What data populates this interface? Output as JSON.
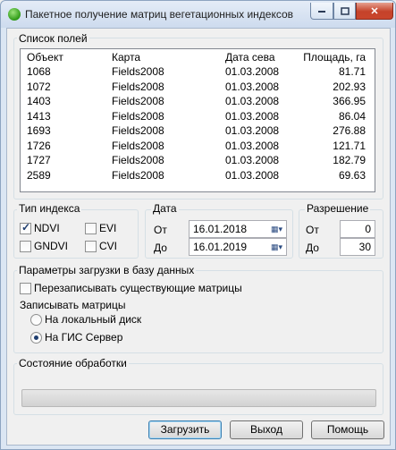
{
  "window": {
    "title": "Пакетное получение матриц вегетационных индексов",
    "close_glyph": "✕"
  },
  "fields_list": {
    "group_title": "Список полей",
    "columns": [
      "Объект",
      "Карта",
      "Дата сева",
      "Площадь, га"
    ],
    "rows": [
      [
        "1068",
        "Fields2008",
        "01.03.2008",
        "81.71"
      ],
      [
        "1072",
        "Fields2008",
        "01.03.2008",
        "202.93"
      ],
      [
        "1403",
        "Fields2008",
        "01.03.2008",
        "366.95"
      ],
      [
        "1413",
        "Fields2008",
        "01.03.2008",
        "86.04"
      ],
      [
        "1693",
        "Fields2008",
        "01.03.2008",
        "276.88"
      ],
      [
        "1726",
        "Fields2008",
        "01.03.2008",
        "121.71"
      ],
      [
        "1727",
        "Fields2008",
        "01.03.2008",
        "182.79"
      ],
      [
        "2589",
        "Fields2008",
        "01.03.2008",
        "69.63"
      ]
    ]
  },
  "index_type": {
    "group_title": "Тип индекса",
    "options": [
      {
        "label": "NDVI",
        "checked": true
      },
      {
        "label": "EVI",
        "checked": false
      },
      {
        "label": "GNDVI",
        "checked": false
      },
      {
        "label": "CVI",
        "checked": false
      }
    ]
  },
  "date": {
    "group_title": "Дата",
    "from_label": "От",
    "from_value": "16.01.2018",
    "to_label": "До",
    "to_value": "16.01.2019"
  },
  "resolution": {
    "group_title": "Разрешение",
    "from_label": "От",
    "from_value": "0",
    "to_label": "До",
    "to_value": "30"
  },
  "db_params": {
    "group_title": "Параметры загрузки в базу данных",
    "overwrite_label": "Перезаписывать существующие матрицы",
    "overwrite_checked": false,
    "write_matrices_label": "Записывать матрицы",
    "targets": [
      {
        "label": "На локальный диск",
        "selected": false
      },
      {
        "label": "На ГИС Сервер",
        "selected": true
      }
    ]
  },
  "processing": {
    "group_title": "Состояние обработки",
    "progress": 0
  },
  "buttons": {
    "load": "Загрузить",
    "exit": "Выход",
    "help": "Помощь"
  }
}
